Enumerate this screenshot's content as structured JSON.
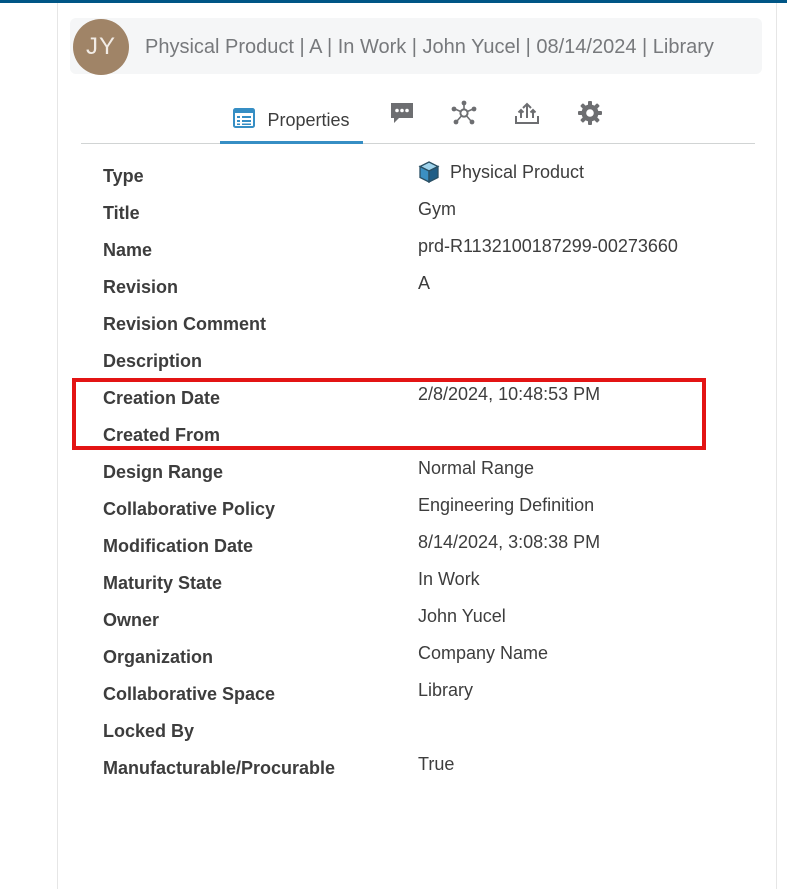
{
  "header": {
    "avatar_initials": "JY",
    "title": "Physical Product | A | In Work | John Yucel | 08/14/2024 | Library"
  },
  "tabs": [
    {
      "label": "Properties",
      "icon": "properties-list-icon",
      "active": true
    },
    {
      "label": "",
      "icon": "comment-icon"
    },
    {
      "label": "",
      "icon": "relations-icon"
    },
    {
      "label": "",
      "icon": "share-upload-icon"
    },
    {
      "label": "",
      "icon": "gear-icon"
    }
  ],
  "colors": {
    "accent": "#368ec4",
    "top_bar": "#005686",
    "avatar_bg": "#a08467",
    "highlight": "#e31414"
  },
  "properties": [
    {
      "label": "Type",
      "value": "Physical Product",
      "icon": "physical-product-cube-icon"
    },
    {
      "label": "Title",
      "value": "Gym"
    },
    {
      "label": "Name",
      "value": "prd-R1132100187299-00273660"
    },
    {
      "label": "Revision",
      "value": "A"
    },
    {
      "label": "Revision Comment",
      "value": ""
    },
    {
      "label": "Description",
      "value": ""
    },
    {
      "label": "Creation Date",
      "value": "2/8/2024, 10:48:53 PM"
    },
    {
      "label": "Created From",
      "value": ""
    },
    {
      "label": "Design Range",
      "value": "Normal Range"
    },
    {
      "label": "Collaborative Policy",
      "value": "Engineering Definition"
    },
    {
      "label": "Modification Date",
      "value": "8/14/2024, 3:08:38 PM"
    },
    {
      "label": "Maturity State",
      "value": "In Work"
    },
    {
      "label": "Owner",
      "value": "John Yucel"
    },
    {
      "label": "Organization",
      "value": "Company Name"
    },
    {
      "label": "Collaborative Space",
      "value": "Library"
    },
    {
      "label": "Locked By",
      "value": ""
    },
    {
      "label": "Manufacturable/Procurable",
      "value": "True"
    }
  ]
}
